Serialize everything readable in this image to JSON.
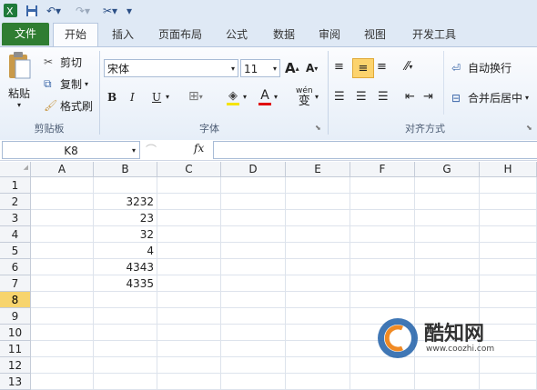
{
  "quick_access": {
    "icons": [
      "excel-logo-icon",
      "save-icon",
      "undo-icon",
      "redo-icon",
      "tools-icon",
      "customize-icon"
    ]
  },
  "tabs": [
    "文件",
    "开始",
    "插入",
    "页面布局",
    "公式",
    "数据",
    "审阅",
    "视图",
    "开发工具"
  ],
  "ribbon": {
    "clipboard": {
      "paste": "粘贴",
      "cut": "剪切",
      "copy": "复制",
      "format_painter": "格式刷",
      "group": "剪贴板"
    },
    "font": {
      "name": "宋体",
      "size": "11",
      "bold": "B",
      "italic": "I",
      "underline": "U",
      "font_color_glyph": "A",
      "phonetic": "wén",
      "phonetic_char": "变",
      "group": "字体"
    },
    "alignment": {
      "wrap": "自动换行",
      "merge": "合并后居中",
      "group": "对齐方式"
    }
  },
  "formula_bar": {
    "name_box": "K8",
    "fx": "fx",
    "value": ""
  },
  "sheet": {
    "columns": [
      "A",
      "B",
      "C",
      "D",
      "E",
      "F",
      "G",
      "H"
    ],
    "rows": [
      "1",
      "2",
      "3",
      "4",
      "5",
      "6",
      "7",
      "8",
      "9",
      "10",
      "11",
      "12",
      "13"
    ],
    "selected_row": "8",
    "column_b_values": [
      "",
      "3232",
      "23",
      "32",
      "4",
      "4343",
      "4335",
      "",
      "",
      "",
      "",
      "",
      ""
    ]
  },
  "watermark": {
    "name": "酷知网",
    "url": "www.coozhi.com"
  },
  "colors": {
    "file_tab": "#2f7d32",
    "ribbon_bg": "#e6eef8",
    "selected_row_header": "#f7d46d"
  }
}
